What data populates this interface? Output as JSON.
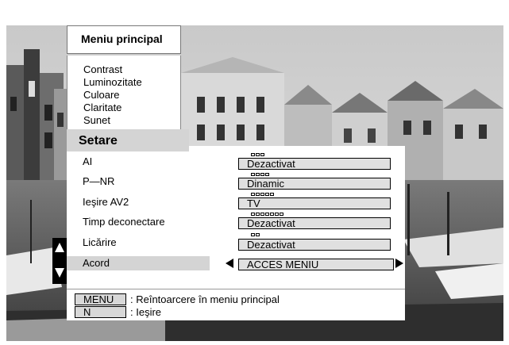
{
  "main_menu": {
    "title": "Meniu principal",
    "items": [
      "Contrast",
      "Luminozitate",
      "Culoare",
      "Claritate",
      "Sunet"
    ]
  },
  "setup": {
    "title": "Setare",
    "rows": [
      {
        "label": "AI",
        "value": "Dezactivat",
        "dots": 3,
        "selected": false
      },
      {
        "label": "P—NR",
        "value": "Dinamic",
        "dots": 4,
        "selected": false
      },
      {
        "label": "Ieşire AV2",
        "value": "TV",
        "dots": 5,
        "selected": false
      },
      {
        "label": "Timp deconectare",
        "value": "Dezactivat",
        "dots": 7,
        "selected": false
      },
      {
        "label": "Licărire",
        "value": "Dezactivat",
        "dots": 2,
        "selected": false
      },
      {
        "label": "Acord",
        "value": "ACCES MENIU",
        "dots": 0,
        "selected": true
      }
    ]
  },
  "footer": {
    "menu_key": "MENU",
    "menu_desc": ": Reîntoarcere în meniu principal",
    "exit_key": "N",
    "exit_desc": ": Ieşire"
  },
  "colors": {
    "highlight": "#d4d4d4",
    "value_box": "#e0e0e0"
  },
  "icons": {
    "scroll_up": "triangle-up-icon",
    "scroll_down": "triangle-down-icon",
    "value_left": "triangle-left-icon",
    "value_right": "triangle-right-icon"
  }
}
